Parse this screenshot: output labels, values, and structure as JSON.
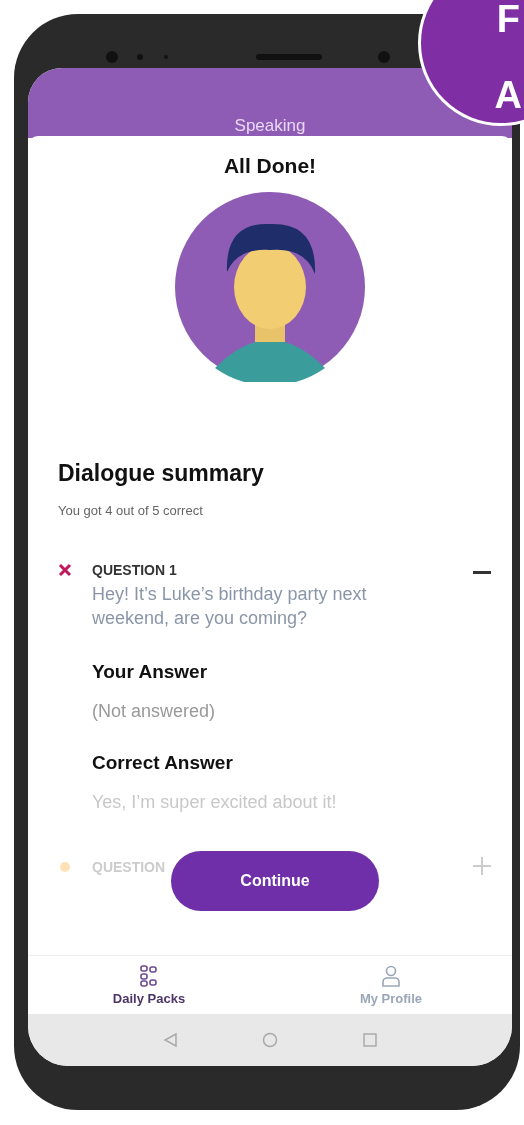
{
  "corner_badge": {
    "letters": [
      "F",
      "A"
    ]
  },
  "header": {
    "title": "Speaking"
  },
  "result": {
    "title": "All Done!"
  },
  "summary": {
    "title": "Dialogue summary",
    "score": "You got 4 out of 5 correct"
  },
  "questions": [
    {
      "kind": "wrong",
      "label": "QUESTION 1",
      "expanded": true,
      "prompt": "Hey! It’s Luke’s birthday party next weekend, are you coming?",
      "your_answer_label": "Your Answer",
      "your_answer": "(Not answered)",
      "correct_answer_label": "Correct Answer",
      "correct_answer": "Yes, I’m super excited about it!"
    },
    {
      "kind": "partial",
      "label": "QUESTION",
      "expanded": false
    }
  ],
  "continue_button": {
    "label": "Continue"
  },
  "bottom_nav": [
    {
      "label": "Daily Packs",
      "kind": "packs",
      "selected": true
    },
    {
      "label": "My Profile",
      "kind": "profile",
      "selected": false
    }
  ]
}
